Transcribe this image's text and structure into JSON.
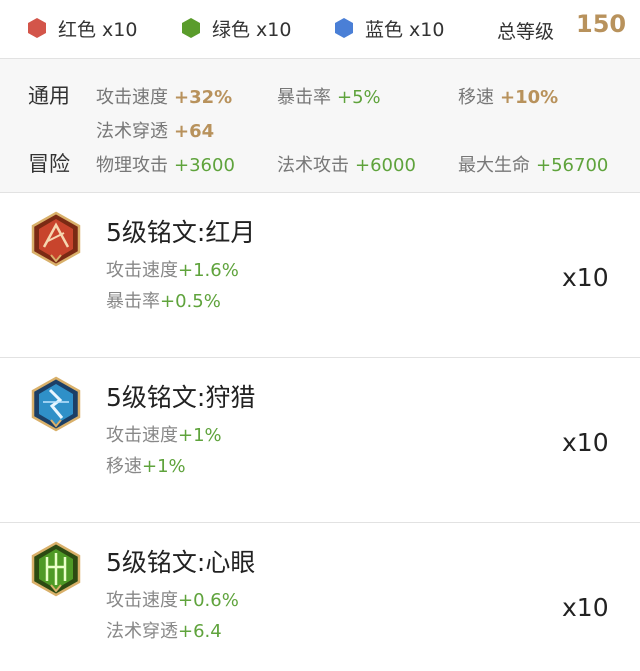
{
  "summary": {
    "slots": [
      {
        "label": "红色 x10",
        "color": "#d3554a",
        "icon": "red-hexagon-icon"
      },
      {
        "label": "绿色 x10",
        "color": "#5a9c2b",
        "icon": "green-hexagon-icon"
      },
      {
        "label": "蓝色 x10",
        "color": "#4a7fd6",
        "icon": "blue-hexagon-icon"
      }
    ],
    "total_label": "总等级",
    "total_value": "150"
  },
  "stats": {
    "general": {
      "label": "通用",
      "items": [
        {
          "name": "攻击速度",
          "value": "+32%"
        },
        {
          "name": "暴击率",
          "value": "+5%"
        },
        {
          "name": "移速",
          "value": "+10%"
        },
        {
          "name": "法术穿透",
          "value": "+64"
        }
      ]
    },
    "adventure": {
      "label": "冒险",
      "items": [
        {
          "name": "物理攻击",
          "value": "+3600"
        },
        {
          "name": "法术攻击",
          "value": "+6000"
        },
        {
          "name": "最大生命",
          "value": "+56700"
        }
      ]
    }
  },
  "runes": [
    {
      "title": "5级铭文:红月",
      "icon": "red-moon-rune-icon",
      "color": "#c8442c",
      "stats": [
        {
          "name": "攻击速度",
          "value": "+1.6%"
        },
        {
          "name": "暴击率",
          "value": "+0.5%"
        }
      ],
      "count": "x10"
    },
    {
      "title": "5级铭文:狩猎",
      "icon": "hunt-rune-icon",
      "color": "#2f90c8",
      "stats": [
        {
          "name": "攻击速度",
          "value": "+1%"
        },
        {
          "name": "移速",
          "value": "+1%"
        }
      ],
      "count": "x10"
    },
    {
      "title": "5级铭文:心眼",
      "icon": "mind-eye-rune-icon",
      "color": "#4f9a26",
      "stats": [
        {
          "name": "攻击速度",
          "value": "+0.6%"
        },
        {
          "name": "法术穿透",
          "value": "+6.4"
        }
      ],
      "count": "x10"
    }
  ]
}
